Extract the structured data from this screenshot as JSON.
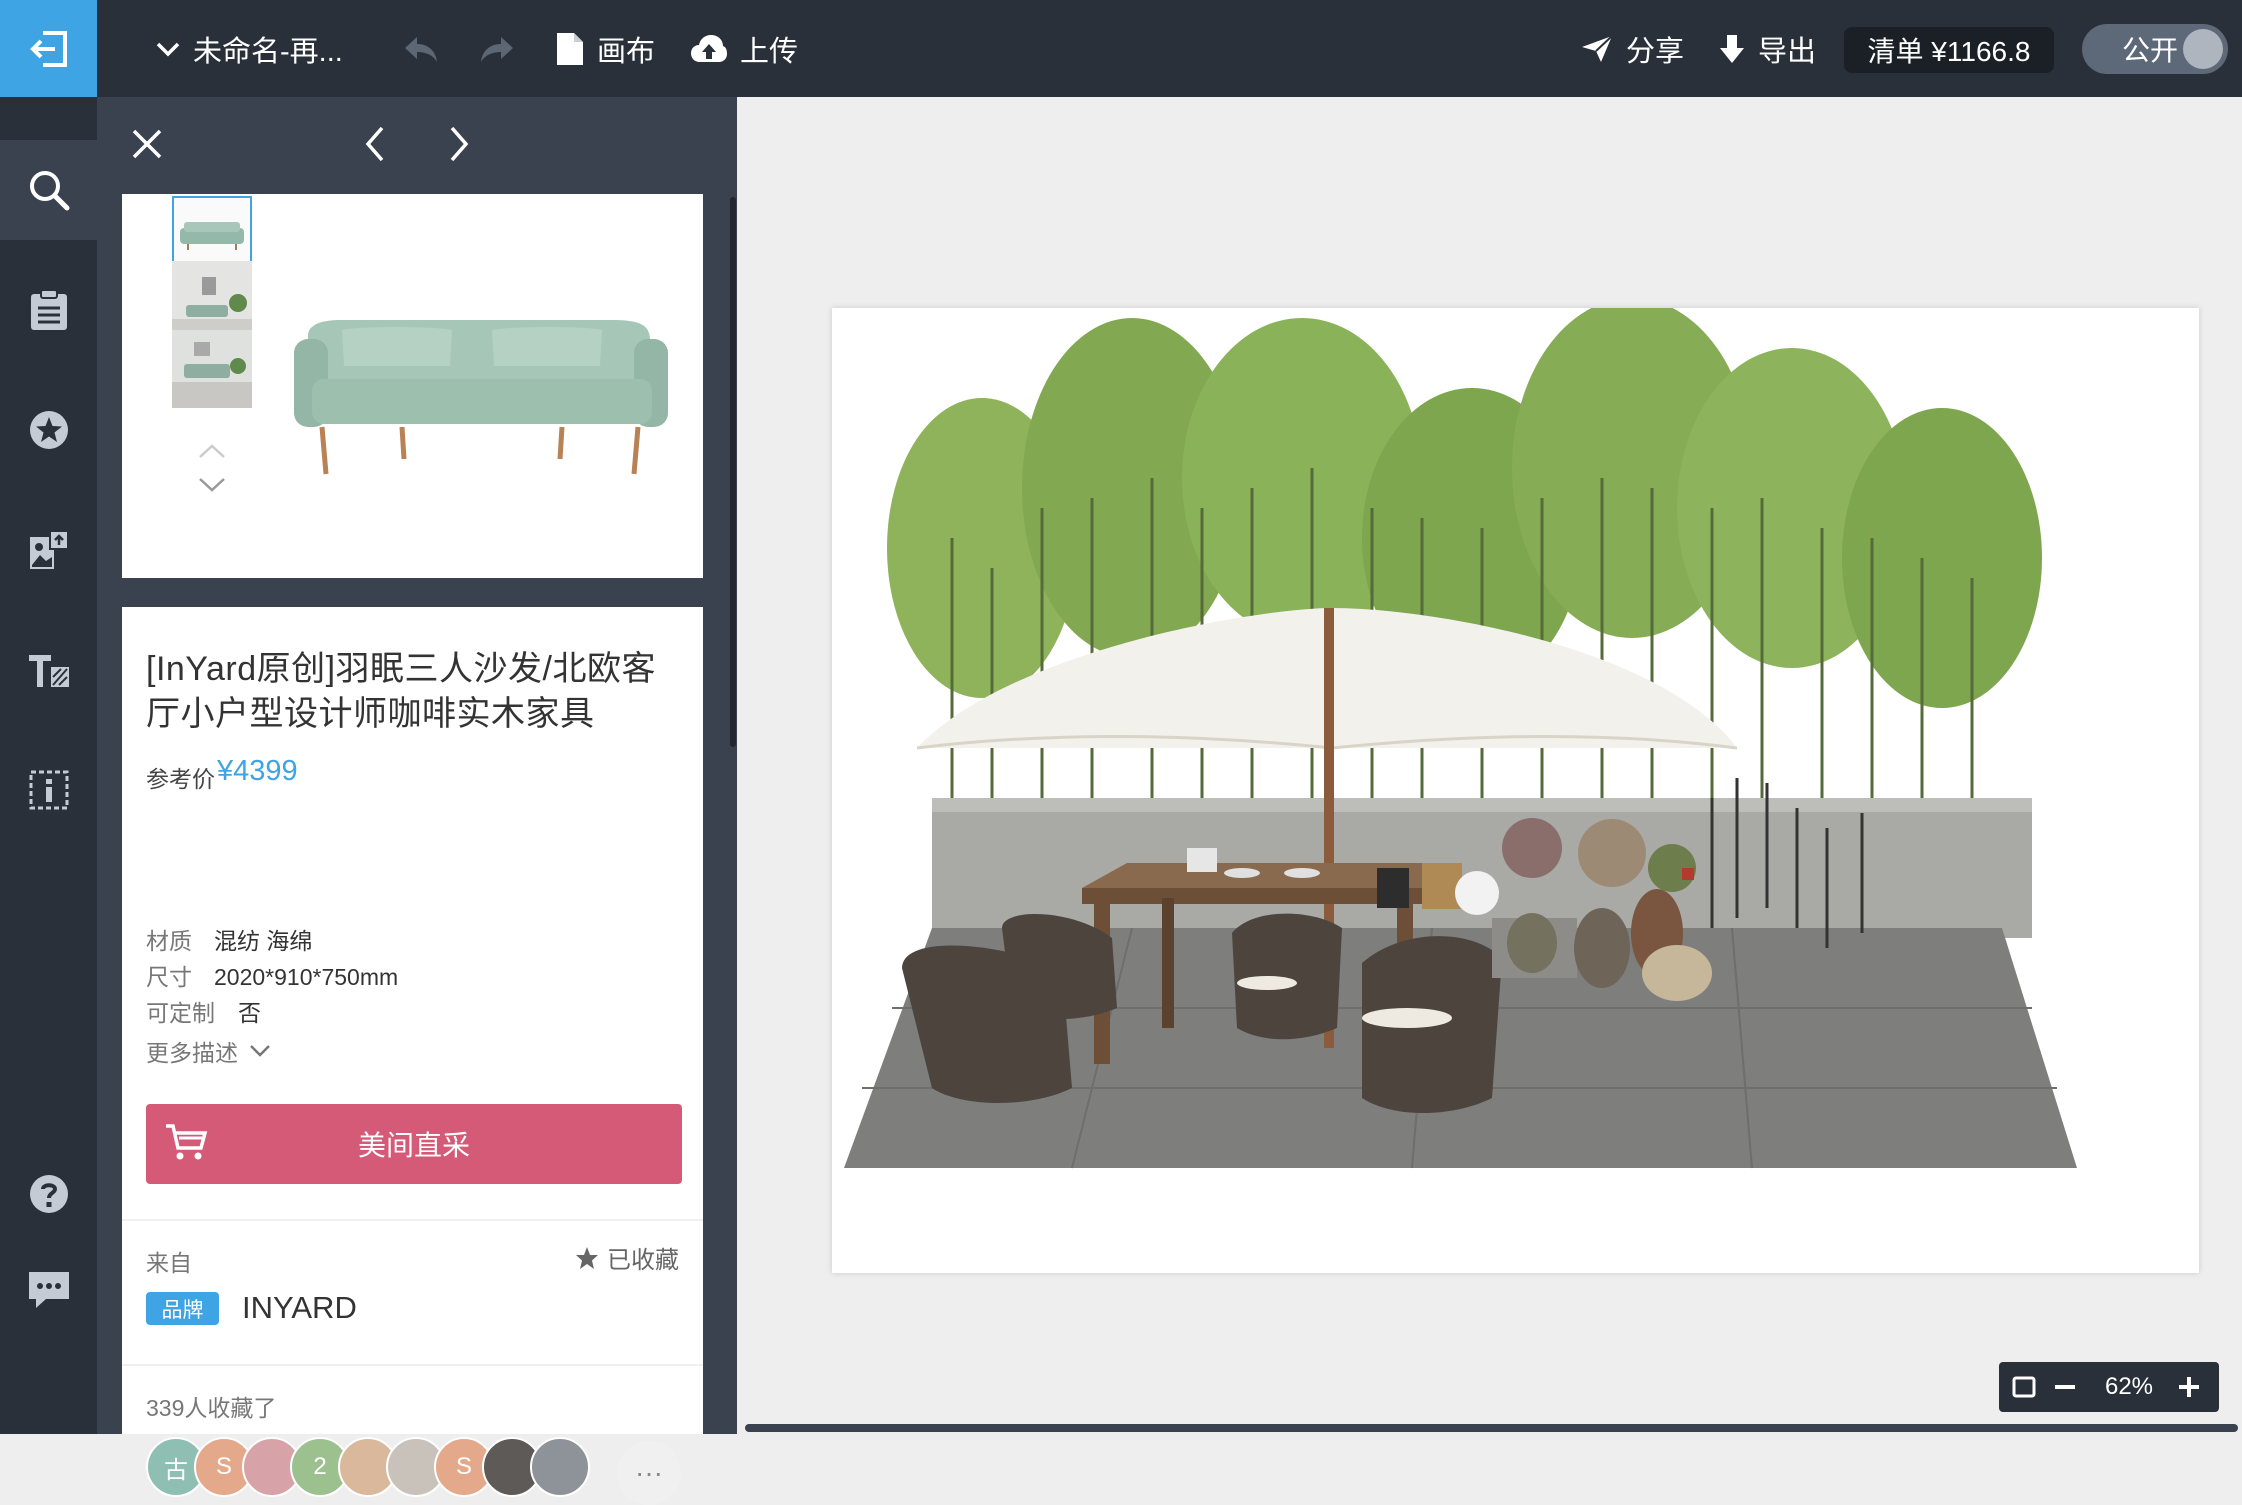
{
  "topbar": {
    "doc_title": "未命名-再...",
    "canvas_label": "画布",
    "upload_label": "上传",
    "share_label": "分享",
    "export_label": "导出",
    "cart_label": "清单 ¥1166.8",
    "public_label": "公开"
  },
  "product": {
    "title": "[InYard原创]羽眠三人沙发/北欧客厅小户型设计师咖啡实木家具",
    "price_label": "参考价",
    "price": "¥4399",
    "specs": [
      {
        "label": "材质",
        "value": "混纺 海绵"
      },
      {
        "label": "尺寸",
        "value": "2020*910*750mm"
      },
      {
        "label": "可定制",
        "value": "否"
      }
    ],
    "more_desc": "更多描述",
    "buy_label": "美间直采",
    "from_label": "来自",
    "collected_label": "已收藏",
    "brand_badge": "品牌",
    "brand_name": "INYARD",
    "fav_count": "339人收藏了",
    "avatars": [
      {
        "text": "古",
        "color": "#8fbfb3"
      },
      {
        "text": "S",
        "color": "#e4a98a"
      },
      {
        "text": "",
        "color": "#d8a3a8"
      },
      {
        "text": "2",
        "color": "#9cc18f"
      },
      {
        "text": "",
        "color": "#d9b89c"
      },
      {
        "text": "",
        "color": "#c8c2ba"
      },
      {
        "text": "S",
        "color": "#e4a98a"
      },
      {
        "text": "",
        "color": "#5d5a58"
      },
      {
        "text": "",
        "color": "#8d9399"
      }
    ],
    "avatar_more": "···"
  },
  "zoom": {
    "value": "62%"
  },
  "colors": {
    "accent": "#3fa4e3",
    "buy_button": "#d45a78",
    "dark_bg": "#2a3039",
    "panel_bg": "#3a4250"
  }
}
